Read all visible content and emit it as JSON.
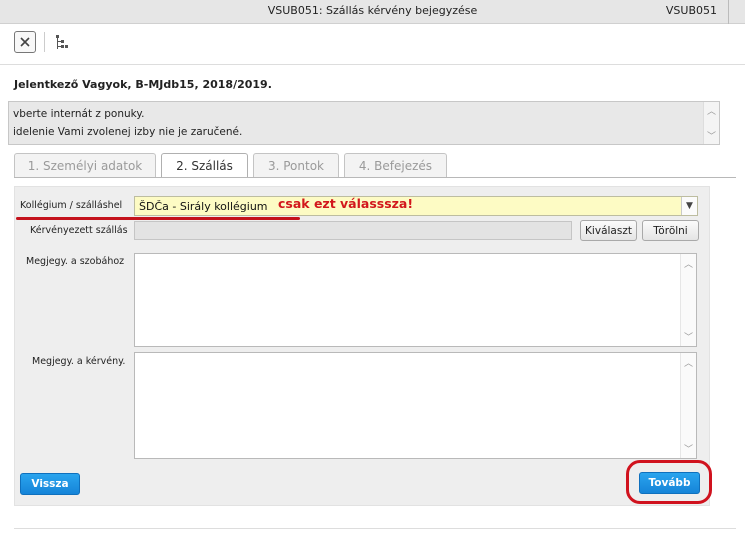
{
  "window": {
    "title": "VSUB051: Szállás kérvény bejegyzése",
    "code": "VSUB051"
  },
  "toolbar": {
    "close_icon": "close-icon",
    "tree_icon": "hierarchy-icon"
  },
  "header": {
    "line": "Jelentkező Vagyok, B-MJdb15, 2018/2019."
  },
  "info": {
    "line1": "vberte internát z ponuky.",
    "line2": "idelenie Vami zvolenej izby nie je zaručené."
  },
  "tabs": [
    {
      "label": "1. Személyi adatok",
      "active": false
    },
    {
      "label": "2. Szállás",
      "active": true
    },
    {
      "label": "3. Pontok",
      "active": false
    },
    {
      "label": "4. Befejezés",
      "active": false
    }
  ],
  "form": {
    "kollegium_label": "Kollégium / szálláshel",
    "kollegium_value": "ŠDČa - Sirály kollégium",
    "annotation": "csak ezt válasssza!",
    "kervenyezett_label": "Kérvényezett szállás",
    "kervenyezett_value": "",
    "kivalaszt_label": "Kiválaszt",
    "torolni_label": "Törölni",
    "szoba_label": "Megjegy. a szobához",
    "kerveny_label": "Megjegy. a kérvény."
  },
  "buttons": {
    "back": "Vissza",
    "next": "Tovább"
  },
  "colors": {
    "accent": "#1a8fe0",
    "highlight": "#d0121e",
    "select_bg": "#fdfbc4"
  }
}
